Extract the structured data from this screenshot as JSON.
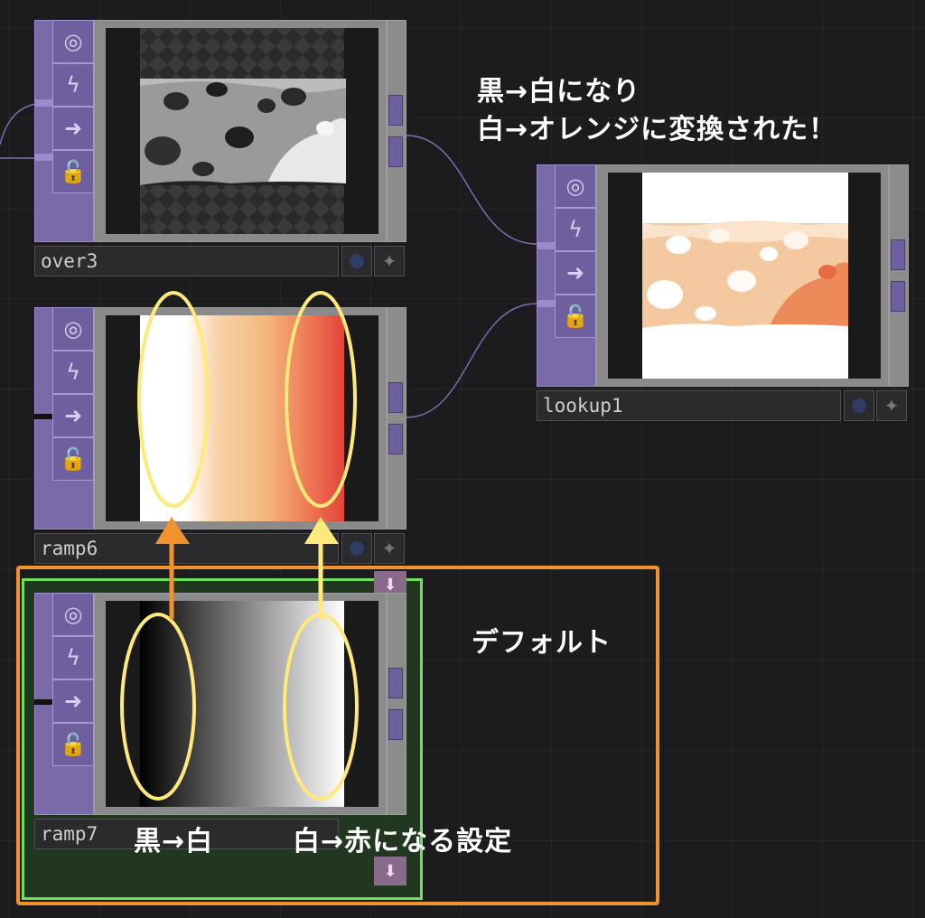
{
  "nodes": {
    "over3": {
      "name": "over3"
    },
    "ramp6": {
      "name": "ramp6"
    },
    "ramp7": {
      "name": "ramp7"
    },
    "lookup1": {
      "name": "lookup1"
    }
  },
  "annotations": {
    "top_line1": "黒→白になり",
    "top_line2": "白→オレンジに変換された！",
    "default": "デフォルト",
    "black_to_white": "黒→白",
    "white_to_red": "白→赤になる設定"
  },
  "colors": {
    "node_purple": "#7a6aa8",
    "highlight_orange": "#f0922e",
    "highlight_yellow": "#ffe97a",
    "selection_green": "#6fe05a"
  },
  "icons": [
    "viewer-icon",
    "bypass-icon",
    "cook-icon",
    "lock-icon",
    "display-dot-icon",
    "wire-icon",
    "output-arrow-icon"
  ]
}
